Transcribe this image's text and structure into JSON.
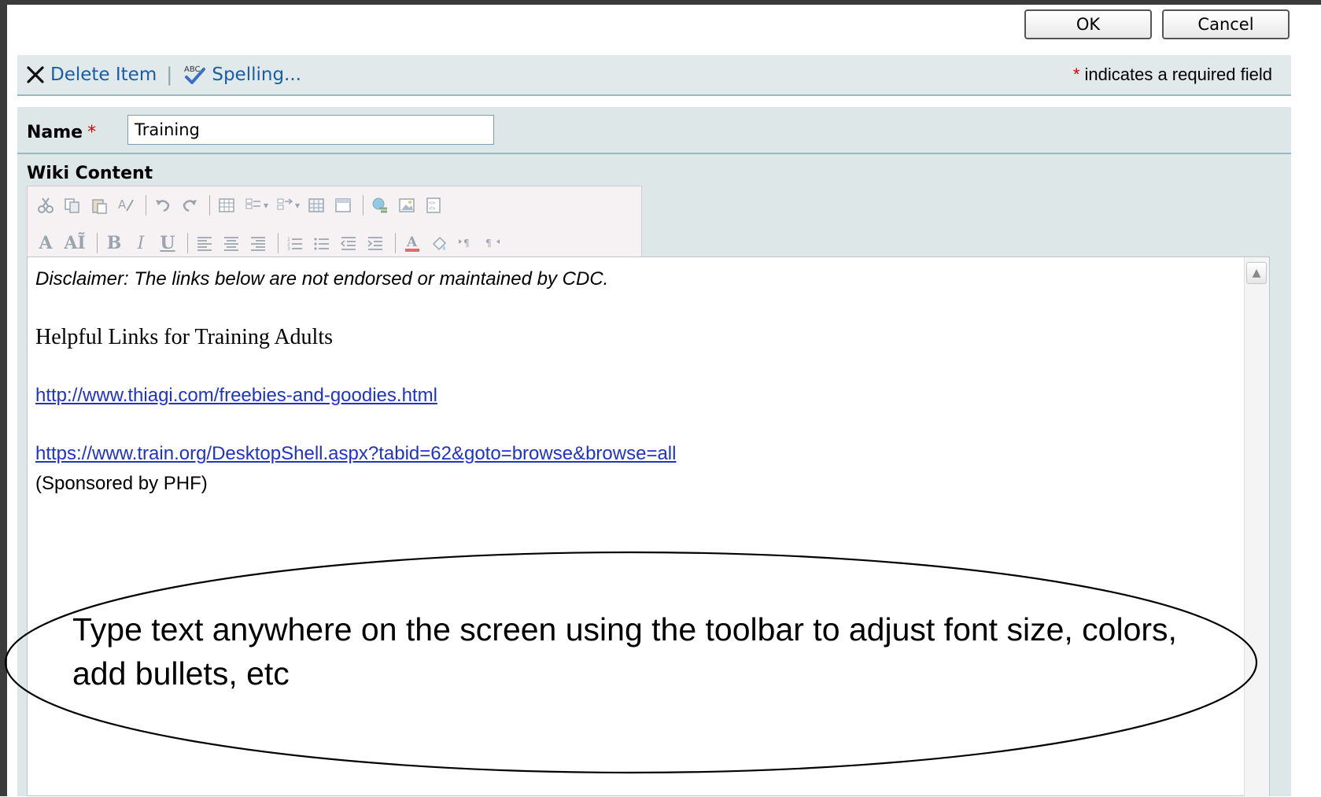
{
  "header": {
    "ok_label": "OK",
    "cancel_label": "Cancel"
  },
  "actions": {
    "delete_label": "Delete Item",
    "separator": "|",
    "spelling_label": "Spelling...",
    "required_star": "*",
    "required_note": "indicates a required field"
  },
  "form": {
    "name_label": "Name",
    "name_required": "*",
    "name_value": "Training",
    "wiki_label": "Wiki Content"
  },
  "toolbar": {
    "row1_icons": [
      "cut-icon",
      "copy-icon",
      "paste-icon",
      "format-painter-icon",
      "undo-icon",
      "redo-icon",
      "insert-table-icon",
      "table-options-icon",
      "insert-row-icon",
      "table-properties-icon",
      "cell-properties-icon",
      "insert-link-icon",
      "insert-image-icon",
      "edit-source-icon"
    ],
    "row2": {
      "font_name": "A",
      "font_size": "AĨ",
      "bold": "B",
      "italic": "I",
      "underline": "U"
    }
  },
  "editor": {
    "disclaimer": "Disclaimer:  The links below are not endorsed or maintained by CDC.",
    "heading": "Helpful Links for Training Adults",
    "link1": "http://www.thiagi.com/freebies-and-goodies.html",
    "link2": "https://www.train.org/DesktopShell.aspx?tabid=62&goto=browse&browse=all",
    "sponsor": "(Sponsored by PHF)"
  },
  "callout": {
    "text": "Type text anywhere on the screen using the toolbar to adjust font size, colors, add bullets, etc"
  },
  "colors": {
    "link": "#1f33c9",
    "action_link": "#1a5da4",
    "required": "#d40000",
    "panel_bg": "#dde7e8"
  }
}
